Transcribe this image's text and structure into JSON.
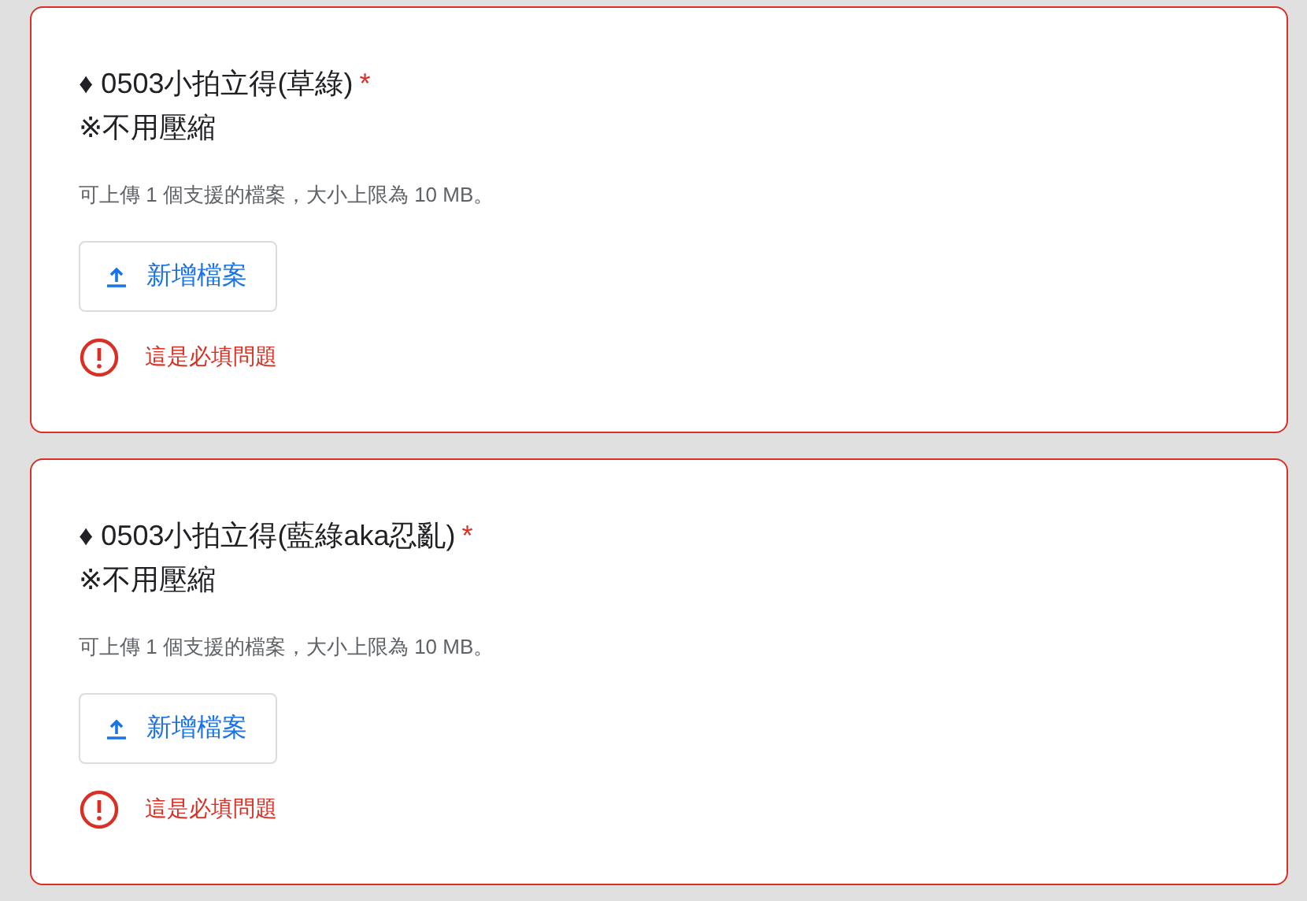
{
  "questions": [
    {
      "title": "♦ 0503小拍立得(草綠)",
      "required": true,
      "required_mark": "*",
      "note": "※不用壓縮",
      "hint": "可上傳 1 個支援的檔案，大小上限為 10 MB。",
      "upload_button": "新增檔案",
      "has_error": true,
      "error": "這是必填問題"
    },
    {
      "title": "♦ 0503小拍立得(藍綠aka忍亂)",
      "required": true,
      "required_mark": "*",
      "note": "※不用壓縮",
      "hint": "可上傳 1 個支援的檔案，大小上限為 10 MB。",
      "upload_button": "新增檔案",
      "has_error": true,
      "error": "這是必填問題"
    }
  ]
}
